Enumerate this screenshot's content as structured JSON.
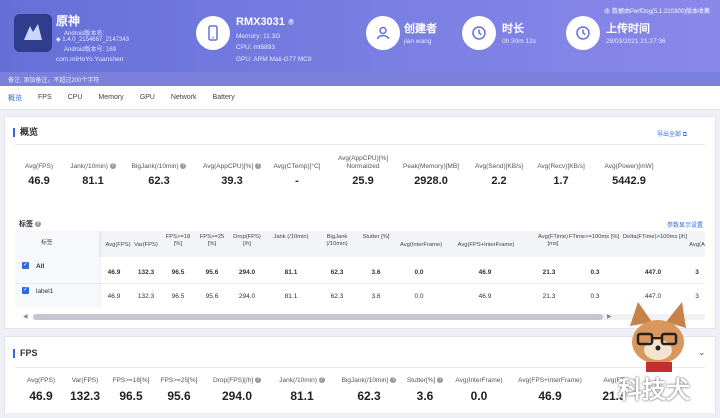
{
  "app": {
    "name": "原神",
    "android_version": "Android版本名:",
    "version_name": "1.4.0_2154667_2147343",
    "version_code": "Android版本号: 169",
    "package": "com.miHoYo.Yuanshen"
  },
  "device": {
    "model": "RMX3031",
    "memory": "Memory: 11.3G",
    "cpu": "CPU: mt6893",
    "gpu": "GPU: ARM Mali-G77 MC9"
  },
  "creator": {
    "label": "创建者",
    "value": "jian wang"
  },
  "duration": {
    "label": "时长",
    "value": "0h 30m 12s"
  },
  "upload": {
    "label": "上传时间",
    "value": "28/03/2021 21:27:36"
  },
  "version_note": "数据由PerfDog(5.1.210300)版本收集",
  "note": "备注: 添加备注，不超过200个字符",
  "tabs": [
    "概览",
    "FPS",
    "CPU",
    "Memory",
    "GPU",
    "Network",
    "Battery"
  ],
  "overview": {
    "title": "概览",
    "export": "导出全部",
    "metrics": [
      {
        "label": "Avg(FPS)",
        "value": "46.9"
      },
      {
        "label": "Jank(/10min)",
        "value": "81.1"
      },
      {
        "label": "BigJank(/10min)",
        "value": "62.3"
      },
      {
        "label": "Avg(AppCPU)[%]",
        "value": "39.3"
      },
      {
        "label": "Avg(CTemp)[°C]",
        "value": "-"
      },
      {
        "label": "Avg(AppCPU)[%] Normalized",
        "value": "25.9"
      },
      {
        "label": "Peak(Memory)[MB]",
        "value": "2928.0"
      },
      {
        "label": "Avg(Send)[KB/s]",
        "value": "2.2"
      },
      {
        "label": "Avg(Recv)[KB/s]",
        "value": "1.7"
      },
      {
        "label": "Avg(Power)[mW]",
        "value": "5442.9"
      }
    ]
  },
  "tags": {
    "title": "标签",
    "settings": "参数显示设置",
    "col_label": "标签",
    "columns": [
      "Avg(FPS)",
      "Var(FPS)",
      "FPS>=18 [%]",
      "FPS>=25 [%]",
      "Drop(FPS) [/h]",
      "Jank (/10min)",
      "BigJank (/10min)",
      "Stutter [%]",
      "Avg(InterFrame)",
      "Avg(FPS+InterFrame)",
      "Avg(FTime) [ms]",
      "FTime>=100ms [%]",
      "Delta(FTime)>100ms [/h]",
      "Avg(A"
    ],
    "rows": [
      {
        "name": "All",
        "values": [
          "46.9",
          "132.3",
          "96.5",
          "95.6",
          "294.0",
          "81.1",
          "62.3",
          "3.6",
          "0.0",
          "46.9",
          "21.3",
          "0.3",
          "447.0",
          "3"
        ]
      },
      {
        "name": "label1",
        "values": [
          "46.9",
          "132.3",
          "96.5",
          "95.6",
          "294.0",
          "81.1",
          "62.3",
          "3.6",
          "0.0",
          "46.9",
          "21.3",
          "0.3",
          "447.0",
          "3"
        ]
      }
    ]
  },
  "fps": {
    "title": "FPS",
    "metrics": [
      {
        "label": "Avg(FPS)",
        "value": "46.9"
      },
      {
        "label": "Var(FPS)",
        "value": "132.3"
      },
      {
        "label": "FPS>=18[%]",
        "value": "96.5"
      },
      {
        "label": "FPS>=25[%]",
        "value": "95.6"
      },
      {
        "label": "Drop(FPS)[/h]",
        "value": "294.0"
      },
      {
        "label": "Jank(/10min)",
        "value": "81.1"
      },
      {
        "label": "BigJank(/10min)",
        "value": "62.3"
      },
      {
        "label": "Stutter[%]",
        "value": "3.6"
      },
      {
        "label": "Avg(InterFrame)",
        "value": "0.0"
      },
      {
        "label": "Avg(FPS+InterFrame)",
        "value": "46.9"
      },
      {
        "label": "Avg(FT",
        "value": "21.3"
      }
    ]
  },
  "watermark": "科技犬"
}
